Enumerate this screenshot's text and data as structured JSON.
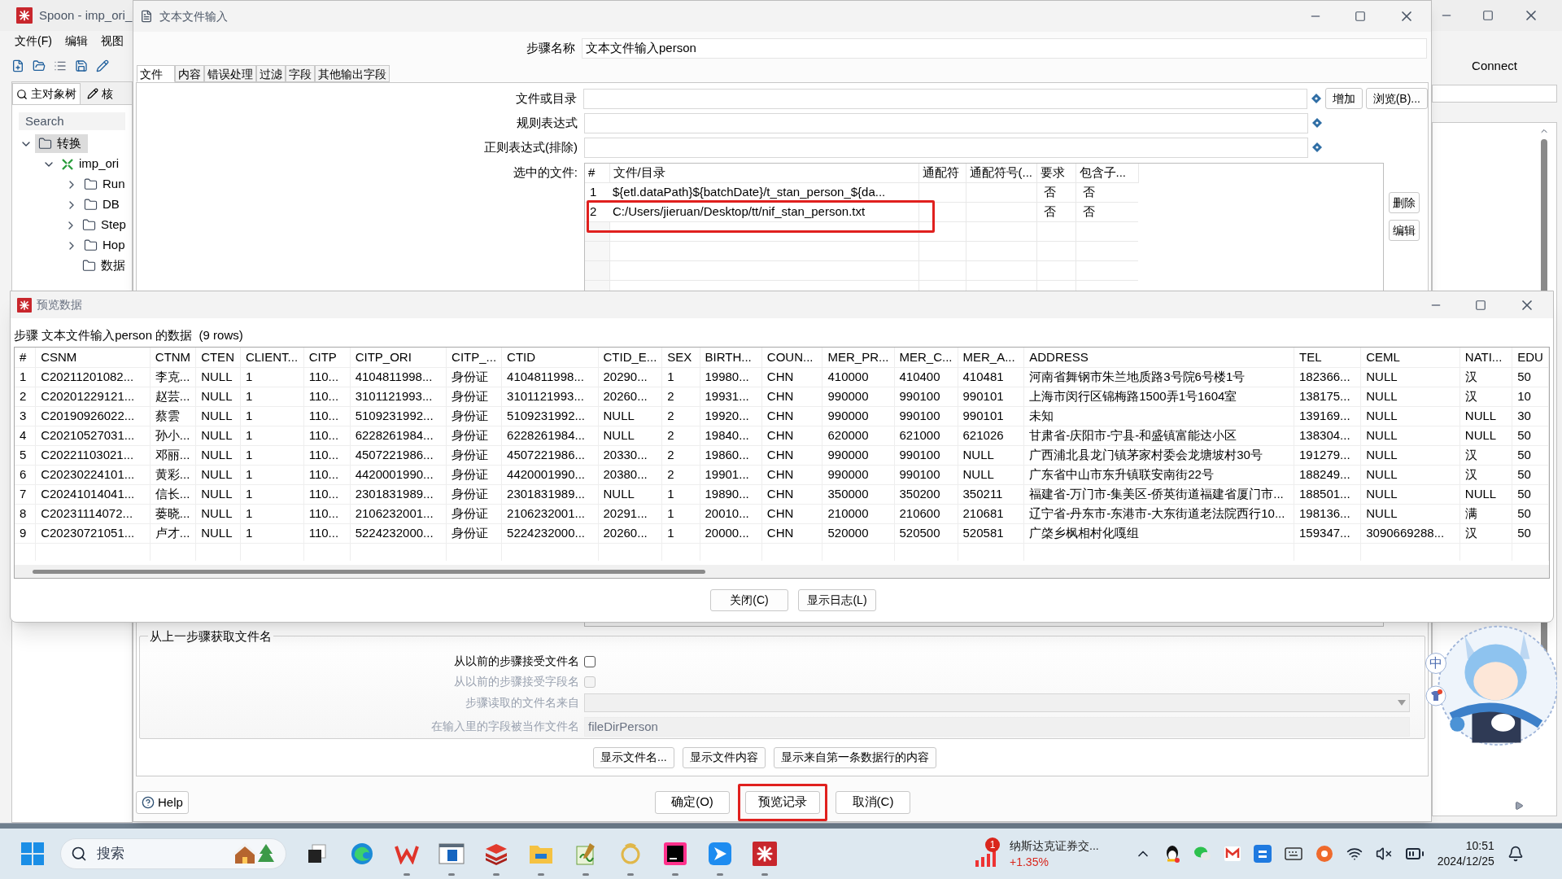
{
  "spoon": {
    "title": "Spoon - imp_ori_",
    "menu": [
      "文件(F)",
      "编辑",
      "视图"
    ],
    "panel_tabs": [
      {
        "label": "主对象树",
        "selected": true
      },
      {
        "label": "核",
        "selected": false
      }
    ],
    "search": {
      "placeholder": "Search"
    },
    "tree": [
      {
        "label": "转换",
        "expandable": true,
        "expanded": true,
        "selected": true,
        "children": [
          {
            "label": "imp_ori",
            "expandable": true,
            "expanded": true,
            "selected": false,
            "children": [
              {
                "label": "Run",
                "expandable": true,
                "expanded": false,
                "selected": false
              },
              {
                "label": "DB",
                "expandable": true,
                "expanded": false,
                "selected": false
              },
              {
                "label": "Step",
                "expandable": true,
                "expanded": false,
                "selected": false
              },
              {
                "label": "Hop",
                "expandable": true,
                "expanded": false,
                "selected": false
              },
              {
                "label": "数据",
                "expandable": false,
                "expanded": false,
                "selected": false
              }
            ]
          }
        ]
      }
    ],
    "connect": "Connect"
  },
  "text_input_dialog": {
    "title": "文本文件输入",
    "step_name": {
      "label": "步骤名称",
      "value": "文本文件输入person"
    },
    "tabs": [
      {
        "label": "文件",
        "selected": true
      },
      {
        "label": "内容",
        "selected": false
      },
      {
        "label": "错误处理",
        "selected": false
      },
      {
        "label": "过滤",
        "selected": false
      },
      {
        "label": "字段",
        "selected": false
      },
      {
        "label": "其他输出字段",
        "selected": false
      }
    ],
    "fields": [
      {
        "label": "文件或目录"
      },
      {
        "label": "规则表达式"
      },
      {
        "label": "正则表达式(排除)"
      }
    ],
    "field_buttons": [
      "增加",
      "浏览(B)..."
    ],
    "selected_files": {
      "label": "选中的文件:",
      "columns": [
        "#",
        "文件/目录",
        "通配符",
        "通配符号(...",
        "要求",
        "包含子..."
      ],
      "rows": [
        {
          "index": "1",
          "path": "${etl.dataPath}${batchDate}/t_stan_person_${da...",
          "required": "否",
          "subfolders": "否",
          "highlighted": false
        },
        {
          "index": "2",
          "path": "C:/Users/jieruan/Desktop/tt/nif_stan_person.txt",
          "required": "否",
          "subfolders": "否",
          "highlighted": true
        }
      ]
    },
    "side_buttons": [
      "删除",
      "编辑"
    ],
    "from_previous": {
      "title": "从上一步骤获取文件名",
      "rows": [
        {
          "kind": "checkbox",
          "label": "从以前的步骤接受文件名",
          "checked": false,
          "disabled": false
        },
        {
          "kind": "checkbox",
          "label": "从以前的步骤接受字段名",
          "checked": false,
          "disabled": true
        },
        {
          "kind": "dropdown",
          "label": "步骤读取的文件名来自",
          "disabled": true
        },
        {
          "kind": "text",
          "label": "在输入里的字段被当作文件名",
          "value": "fileDirPerson",
          "disabled": true
        }
      ]
    },
    "show_buttons": [
      "显示文件名...",
      "显示文件内容",
      "显示来自第一条数据行的内容"
    ],
    "help": "Help",
    "footer_buttons": [
      {
        "label": "确定(O)",
        "highlighted": false
      },
      {
        "label": "预览记录",
        "highlighted": true
      },
      {
        "label": "取消(C)",
        "highlighted": false
      }
    ]
  },
  "preview_dialog": {
    "title": "预览数据",
    "caption": "步骤 文本文件输入person 的数据  (9 rows)",
    "columns": [
      "#",
      "CSNM",
      "CTNM",
      "CTEN",
      "CLIENT...",
      "CITP",
      "CITP_ORI",
      "CITP_...",
      "CTID",
      "CTID_E...",
      "SEX",
      "BIRTH...",
      "COUN...",
      "MER_PR...",
      "MER_C...",
      "MER_A...",
      "ADDRESS",
      "TEL",
      "CEML",
      "NATI...",
      "EDU"
    ],
    "rows": [
      [
        "1",
        "C20211201082...",
        "李克...",
        "NULL",
        "1",
        "110...",
        "4104811998...",
        "身份证",
        "4104811998...",
        "20290...",
        "1",
        "19980...",
        "CHN",
        "410000",
        "410400",
        "410481",
        "河南省舞钢市朱兰地质路3号院6号楼1号",
        "182366...",
        "NULL",
        "汉",
        "50"
      ],
      [
        "2",
        "C20201229121...",
        "赵芸...",
        "NULL",
        "1",
        "110...",
        "3101121993...",
        "身份证",
        "3101121993...",
        "20260...",
        "2",
        "19931...",
        "CHN",
        "990000",
        "990100",
        "990101",
        "上海市闵行区锦梅路1500弄1号1604室",
        "138175...",
        "NULL",
        "汉",
        "10"
      ],
      [
        "3",
        "C20190926022...",
        "蔡雲",
        "NULL",
        "1",
        "110...",
        "5109231992...",
        "身份证",
        "5109231992...",
        "NULL",
        "2",
        "19920...",
        "CHN",
        "990000",
        "990100",
        "990101",
        "未知",
        "139169...",
        "NULL",
        "NULL",
        "30"
      ],
      [
        "4",
        "C20210527031...",
        "孙小...",
        "NULL",
        "1",
        "110...",
        "6228261984...",
        "身份证",
        "6228261984...",
        "NULL",
        "2",
        "19840...",
        "CHN",
        "620000",
        "621000",
        "621026",
        "甘肃省-庆阳市-宁县-和盛镇富能达小区",
        "138304...",
        "NULL",
        "NULL",
        "50"
      ],
      [
        "5",
        "C20221103021...",
        "邓丽...",
        "NULL",
        "1",
        "110...",
        "4507221986...",
        "身份证",
        "4507221986...",
        "20330...",
        "2",
        "19860...",
        "CHN",
        "990000",
        "990100",
        "NULL",
        "广西浦北县龙门镇茅家村委会龙塘坡村30号",
        "191279...",
        "NULL",
        "汉",
        "50"
      ],
      [
        "6",
        "C20230224101...",
        "黄彩...",
        "NULL",
        "1",
        "110...",
        "4420001990...",
        "身份证",
        "4420001990...",
        "20380...",
        "2",
        "19901...",
        "CHN",
        "990000",
        "990100",
        "NULL",
        "广东省中山市东升镇联安南街22号",
        "188249...",
        "NULL",
        "汉",
        "50"
      ],
      [
        "7",
        "C20241014041...",
        "信长...",
        "NULL",
        "1",
        "110...",
        "2301831989...",
        "身份证",
        "2301831989...",
        "NULL",
        "1",
        "19890...",
        "CHN",
        "350000",
        "350200",
        "350211",
        "福建省-万门市-集美区-侨英街道福建省厦门市...",
        "188501...",
        "NULL",
        "NULL",
        "50"
      ],
      [
        "8",
        "C20231114072...",
        "蒌晓...",
        "NULL",
        "1",
        "110...",
        "2106232001...",
        "身份证",
        "2106232001...",
        "20291...",
        "1",
        "20010...",
        "CHN",
        "210000",
        "210600",
        "210681",
        "辽宁省-丹东市-东港市-大东街道老法院西行10...",
        "198136...",
        "NULL",
        "满",
        "50"
      ],
      [
        "9",
        "C20230721051...",
        "卢才...",
        "NULL",
        "1",
        "110...",
        "5224232000...",
        "身份证",
        "5224232000...",
        "20260...",
        "1",
        "20000...",
        "CHN",
        "520000",
        "520500",
        "520581",
        "广棨乡枫相村化嘎组",
        "159347...",
        "3090669288...",
        "汉",
        "50"
      ]
    ],
    "buttons": [
      "关闭(C)",
      "显示日志(L)"
    ]
  },
  "desktop_pet": {
    "ime_label": "中"
  },
  "taskbar": {
    "search": {
      "placeholder": "搜索"
    },
    "apps": [
      {
        "kind": "taskview",
        "running": false
      },
      {
        "kind": "edge",
        "running": false
      },
      {
        "kind": "wps",
        "running": true
      },
      {
        "kind": "window",
        "running": true
      },
      {
        "kind": "redis",
        "running": true
      },
      {
        "kind": "folder",
        "running": true
      },
      {
        "kind": "notepad",
        "running": true
      },
      {
        "kind": "ring",
        "running": true
      },
      {
        "kind": "ide",
        "running": true
      },
      {
        "kind": "arrow",
        "running": true
      },
      {
        "kind": "spoon",
        "running": true
      }
    ],
    "stock": {
      "badge": "1",
      "title": "纳斯达克证券交...",
      "change": "+1.35%"
    },
    "clock": {
      "time": "10:51",
      "date": "2024/12/25"
    }
  }
}
